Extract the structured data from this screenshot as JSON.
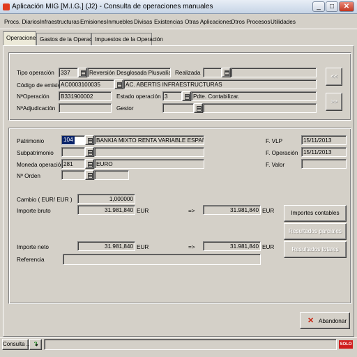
{
  "window": {
    "title": "Aplicación MIG [M.I.G.] (J2) - Consulta de operaciones manuales",
    "minimize": "_",
    "maximize": "□",
    "close": "✕"
  },
  "menu": [
    "Procs. Diarios",
    "Infraestructuras",
    "Emisiones",
    "Inmuebles",
    "Divisas",
    "Existencias",
    "Otras Aplicaciones",
    "Otros Procesos",
    "Utilidades"
  ],
  "tabs": [
    "Operaciones",
    "Gastos de la Operación",
    "Impuestos de la Operación"
  ],
  "top": {
    "tipo_operacion": {
      "label": "Tipo operación",
      "code": "337",
      "desc": "Reversión Desglosada Plusvalías Tác"
    },
    "realizada": {
      "label": "Realizada",
      "value": ""
    },
    "codigo_emision": {
      "label": "Código de emisión",
      "code": "AC0003100035",
      "desc": "AC. ABERTIS INFRAESTRUCTURAS"
    },
    "n_operacion": {
      "label": "NºOperación",
      "value": "B331900002"
    },
    "estado_operacion": {
      "label": "Estado operación",
      "code": "3",
      "desc": "Pdte. Contabilizar."
    },
    "n_adjudicacion": {
      "label": "NºAdjudicación",
      "value": ""
    },
    "gestor": {
      "label": "Gestor",
      "value": ""
    },
    "prev": "<<",
    "next": ">>"
  },
  "detail": {
    "patrimonio": {
      "label": "Patrimonio",
      "code": "104",
      "desc": "BANKIA MIXTO RENTA VARIABLE ESPAÑA, FI"
    },
    "subpatrimonio": {
      "label": "Subpatrimonio",
      "code": "",
      "desc": ""
    },
    "moneda": {
      "label": "Moneda operación",
      "code": "281",
      "desc": "EURO"
    },
    "n_orden": {
      "label": "Nº Orden",
      "code": "",
      "desc": ""
    },
    "f_vlp": {
      "label": "F. VLP",
      "value": "15/11/2013"
    },
    "f_operacion": {
      "label": "F. Operación",
      "value": "15/11/2013"
    },
    "f_valor": {
      "label": "F. Valor",
      "value": ""
    },
    "cambio": {
      "label": "Cambio ( EUR/ EUR )",
      "value": "1,000000"
    },
    "importe_bruto": {
      "label": "Importe bruto",
      "value": "31.981,840",
      "currency": "EUR",
      "arrow": "=>",
      "converted": "31.981,840",
      "currency2": "EUR"
    },
    "importe_neto": {
      "label": "Importe neto",
      "value": "31.981,840",
      "currency": "EUR",
      "arrow": "=>",
      "converted": "31.981,840",
      "currency2": "EUR"
    },
    "referencia": {
      "label": "Referencia",
      "value": ""
    },
    "btn_importes": "Importes contables",
    "btn_parciales": "Resultados parciales",
    "btn_totales": "Resultados totales"
  },
  "footer": {
    "abandonar": "Abandonar",
    "abandonar_icon": "✕"
  },
  "status": {
    "app": "Consulta ...",
    "help": "?",
    "dropdown": "▾",
    "badge": "SOLO"
  }
}
